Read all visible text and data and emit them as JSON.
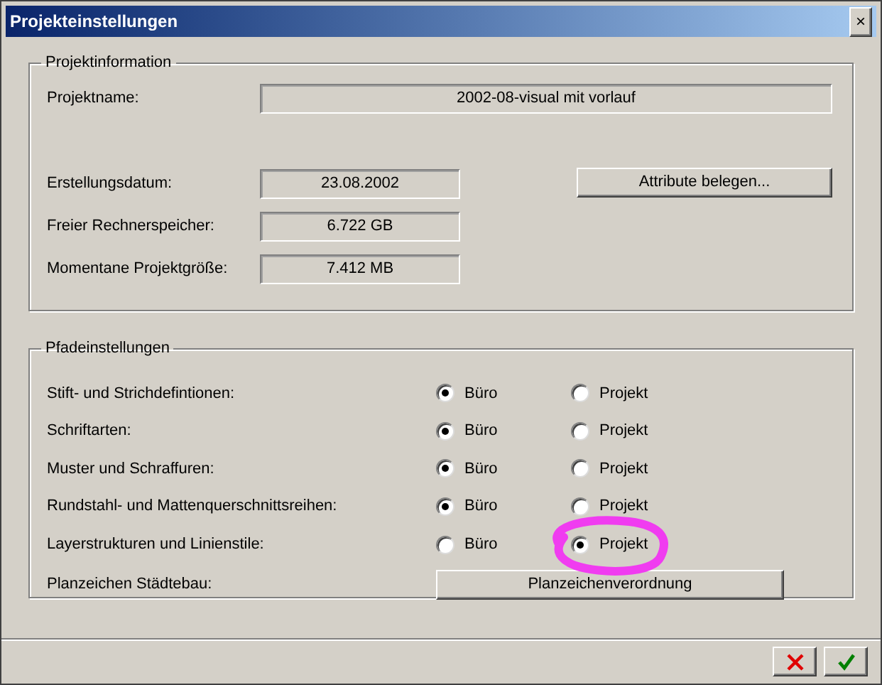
{
  "window": {
    "title": "Projekteinstellungen",
    "close": "×"
  },
  "project_info": {
    "title": "Projektinformation",
    "name": {
      "label": "Projektname:",
      "value": "2002-08-visual mit vorlauf"
    },
    "fields": [
      {
        "label": "Erstellungsdatum:",
        "value": "23.08.2002"
      },
      {
        "label": "Freier Rechnerspeicher:",
        "value": "6.722 GB"
      },
      {
        "label": "Momentane Projektgröße:",
        "value": "7.412 MB"
      }
    ],
    "attributes_button": "Attribute belegen..."
  },
  "path_settings": {
    "title": "Pfadeinstellungen",
    "rows": [
      {
        "label": "Stift- und Strichdefintionen:",
        "circled": false,
        "options": [
          {
            "label": "Büro",
            "selected": true
          },
          {
            "label": "Projekt",
            "selected": false
          }
        ]
      },
      {
        "label": "Schriftarten:",
        "circled": false,
        "options": [
          {
            "label": "Büro",
            "selected": true
          },
          {
            "label": "Projekt",
            "selected": false
          }
        ]
      },
      {
        "label": "Muster und Schraffuren:",
        "circled": false,
        "options": [
          {
            "label": "Büro",
            "selected": true
          },
          {
            "label": "Projekt",
            "selected": false
          }
        ]
      },
      {
        "label": "Rundstahl- und Mattenquerschnittsreihen:",
        "circled": false,
        "options": [
          {
            "label": "Büro",
            "selected": true
          },
          {
            "label": "Projekt",
            "selected": false
          }
        ]
      },
      {
        "label": "Layerstrukturen und Linienstile:",
        "circled": true,
        "options": [
          {
            "label": "Büro",
            "selected": false
          },
          {
            "label": "Projekt",
            "selected": true
          }
        ]
      }
    ],
    "planzeichen": {
      "label": "Planzeichen Städtebau:",
      "button": "Planzeichenverordnung"
    }
  }
}
